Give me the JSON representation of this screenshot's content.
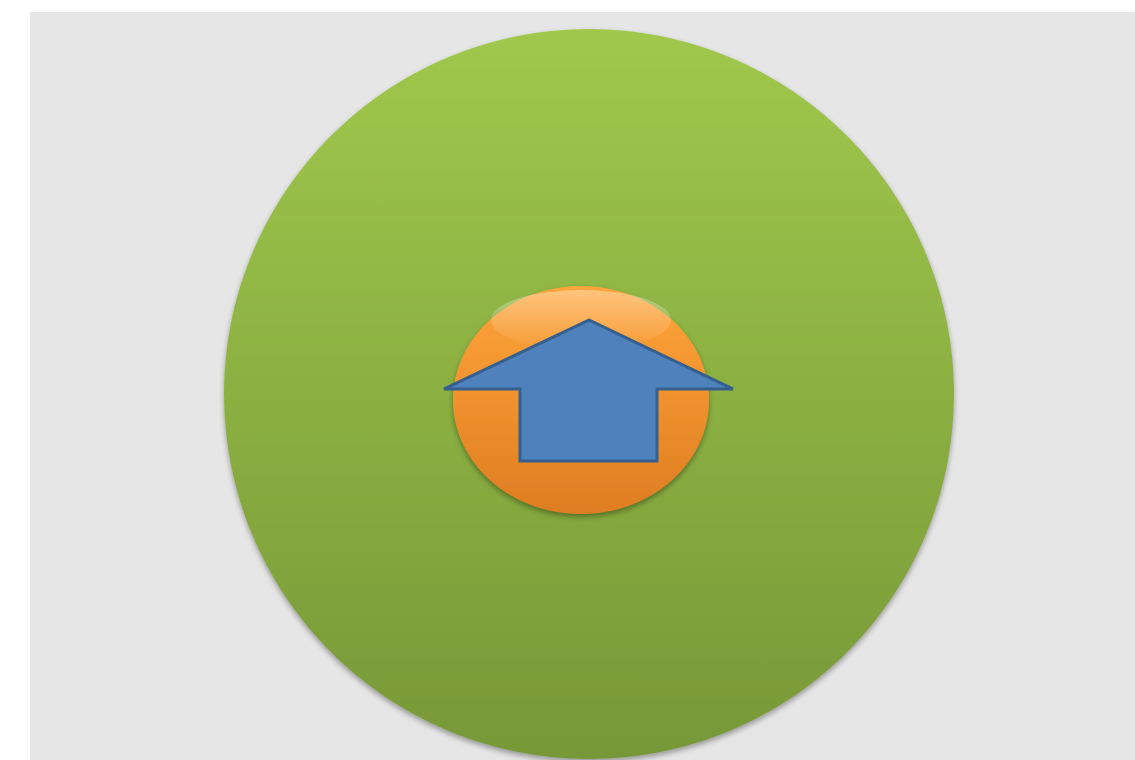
{
  "diagram": {
    "colors": {
      "background": "#e6e6e6",
      "outer_circle_top": "#a0c84c",
      "outer_circle_bottom": "#779837",
      "inner_circle_top": "#ffa53a",
      "inner_circle_bottom": "#de7d22",
      "arrow_fill": "#4f81bd",
      "arrow_stroke": "#355f8f"
    },
    "shapes": {
      "outer": "circle",
      "inner": "ellipse",
      "symbol": "home-arrow-icon"
    }
  }
}
